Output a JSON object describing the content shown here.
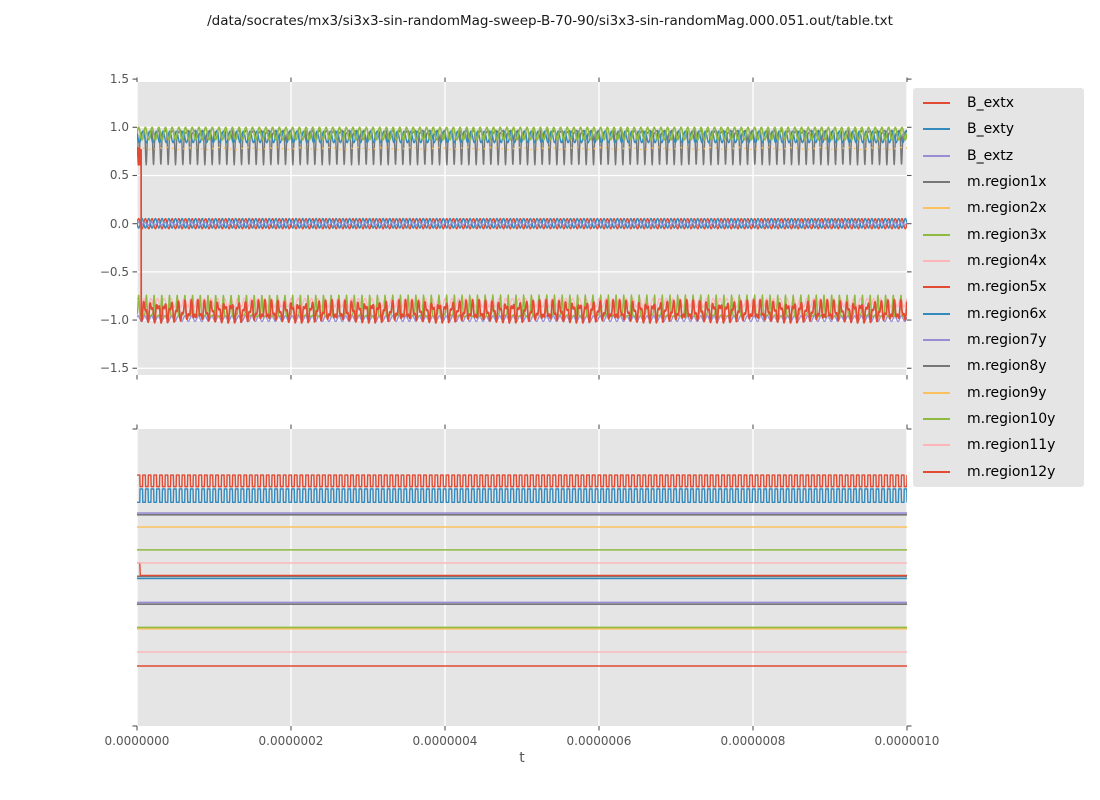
{
  "title": "/data/socrates/mx3/si3x3-sin-randomMag-sweep-B-70-90/si3x3-sin-randomMag.000.051.out/table.txt",
  "colors": {
    "figure_bg": "#ffffff",
    "axes_bg": "#e5e5e5",
    "grid": "#ffffff",
    "tick_mark": "#555555",
    "tick_label": "#555555",
    "title_text": "#1a1a1a",
    "legend_bg": "#e5e5e5",
    "palette_red": "#e24a33",
    "palette_blue": "#348abd",
    "palette_purple": "#988ed5",
    "palette_gray": "#777777",
    "palette_orange": "#fbc15e",
    "palette_green": "#8eba42",
    "palette_pink": "#ffb5b8"
  },
  "legend": {
    "entries": [
      {
        "label": "B_extx",
        "color": "#e24a33"
      },
      {
        "label": "B_exty",
        "color": "#348abd"
      },
      {
        "label": "B_extz",
        "color": "#988ed5"
      },
      {
        "label": "m.region1x",
        "color": "#777777"
      },
      {
        "label": "m.region2x",
        "color": "#fbc15e"
      },
      {
        "label": "m.region3x",
        "color": "#8eba42"
      },
      {
        "label": "m.region4x",
        "color": "#ffb5b8"
      },
      {
        "label": "m.region5x",
        "color": "#e24a33"
      },
      {
        "label": "m.region6x",
        "color": "#348abd"
      },
      {
        "label": "m.region7y",
        "color": "#988ed5"
      },
      {
        "label": "m.region8y",
        "color": "#777777"
      },
      {
        "label": "m.region9y",
        "color": "#fbc15e"
      },
      {
        "label": "m.region10y",
        "color": "#8eba42"
      },
      {
        "label": "m.region11y",
        "color": "#ffb5b8"
      },
      {
        "label": "m.region12y",
        "color": "#e24a33"
      }
    ]
  },
  "chart_data": [
    {
      "type": "line",
      "title": "",
      "xlabel": "",
      "ylabel": "",
      "xlim": [
        0,
        1e-06
      ],
      "ylim": [
        -1.57,
        1.47
      ],
      "xticks": [
        0,
        2e-07,
        4e-07,
        6e-07,
        8e-07,
        1e-06
      ],
      "xtick_labels": [],
      "yticks": [
        1.5,
        1.0,
        0.5,
        0.0,
        -0.5,
        -1.0,
        -1.5
      ],
      "ytick_labels": [
        "1.5",
        "1.0",
        "0.5",
        "0.0",
        "−0.5",
        "−1.0",
        "−1.5"
      ],
      "grid": "white, horizontal and vertical at ticks",
      "legend_position": "outside right",
      "series": [
        {
          "name": "B_extx",
          "color": "#e24a33",
          "wave": "sine",
          "center": 0.0,
          "amp": 0.053,
          "cycles": 115,
          "phase": 0,
          "lw": 1.4
        },
        {
          "name": "B_exty",
          "color": "#348abd",
          "wave": "sine",
          "center": 0.004,
          "amp": 0.05,
          "cycles": 115,
          "phase": 3.14,
          "lw": 1.4
        },
        {
          "name": "B_extz",
          "color": "#988ed5",
          "wave": "sine",
          "center": 0.0,
          "amp": 0.018,
          "cycles": 115,
          "phase": 0.8,
          "lw": 1.3
        },
        {
          "name": "m.region1x",
          "color": "#777777",
          "wave": "spike",
          "base": 0.955,
          "height": -0.345,
          "power": 6,
          "cycles": 105,
          "phase": 0,
          "wobble": 0.015,
          "lw": 1.4
        },
        {
          "name": "m.region2x",
          "color": "#fbc15e",
          "wave": "sine",
          "center": 0.78,
          "amp": 0.012,
          "cycles": 105,
          "phase": 0.9,
          "lw": 1.3,
          "dash": "2 5"
        },
        {
          "name": "m.region6x",
          "color": "#348abd",
          "wave": "sine",
          "center": 0.9,
          "amp": 0.06,
          "cycles": 115,
          "phase": 2.3,
          "lw": 1.4
        },
        {
          "name": "m.region3x",
          "color": "#8eba42",
          "wave": "sine",
          "center": 0.935,
          "amp": 0.065,
          "cycles": 115,
          "phase": 0,
          "lw": 1.6
        },
        {
          "name": "m.region4x",
          "color": "#ffb5b8",
          "wave": "sine",
          "center": -0.82,
          "amp": 0.045,
          "cycles": 115,
          "phase": 1.2,
          "lw": 1.3
        },
        {
          "name": "m.region7y",
          "color": "#988ed5",
          "wave": "sine",
          "center": -0.985,
          "amp": 0.03,
          "cycles": 115,
          "phase": 0.5,
          "lw": 1.3
        },
        {
          "name": "m.region10y",
          "color": "#8eba42",
          "wave": "spike",
          "base": -0.955,
          "height": 0.215,
          "power": 8,
          "cycles": 100,
          "phase": 0.2,
          "wobble": 0.01,
          "lw": 1.4
        },
        {
          "name": "m.region5x",
          "color": "#e24a33",
          "wave": "piecewise",
          "x0": 0.0055,
          "pre": {
            "wave": "sine",
            "center": 0.7,
            "amp": 0.09,
            "cycles": 400,
            "phase": 0
          },
          "post": {
            "wave": "sine2",
            "center": -0.91,
            "amp": 0.075,
            "cycles": 115,
            "phase": 0.9,
            "amp2": 0.045,
            "cycles2": 241,
            "phase2": 1.3
          },
          "lw": 1.7
        }
      ]
    },
    {
      "type": "line",
      "title": "",
      "xlabel": "t",
      "ylabel": "",
      "xlim": [
        0,
        1e-06
      ],
      "ylim": [
        0,
        1
      ],
      "xticks": [
        0,
        2e-07,
        4e-07,
        6e-07,
        8e-07,
        1e-06
      ],
      "xtick_labels": [
        "0.0000000",
        "0.0000002",
        "0.0000004",
        "0.0000006",
        "0.0000008",
        "0.0000010"
      ],
      "yticks": [],
      "ytick_labels": [],
      "note": "no y-axis tick labels shown; y values normalized 0-1 of axes height",
      "series": [
        {
          "id": "gray-flat-under-blue",
          "color": "#777777",
          "wave": "flat",
          "value": 0.504,
          "lw": 1.6
        },
        {
          "id": "blue-flat",
          "color": "#348abd",
          "wave": "flat",
          "value": 0.497,
          "lw": 1.6
        },
        {
          "id": "red-step-down",
          "color": "#e24a33",
          "wave": "step",
          "x0": 0.004,
          "v1": 0.549,
          "v2": 0.507,
          "lw": 1.4
        },
        {
          "id": "gray-flat-under-purple-1",
          "color": "#777777",
          "wave": "flat",
          "value": 0.711,
          "lw": 1.6
        },
        {
          "id": "purple-flat-1",
          "color": "#988ed5",
          "wave": "flat",
          "value": 0.717,
          "lw": 1.6
        },
        {
          "id": "orange-flat-1",
          "color": "#fbc15e",
          "wave": "flat",
          "value": 0.67,
          "lw": 1.4
        },
        {
          "id": "green-flat-1",
          "color": "#8eba42",
          "wave": "flat",
          "value": 0.593,
          "lw": 1.4
        },
        {
          "id": "pink-flat-1",
          "color": "#ffb5b8",
          "wave": "flat",
          "value": 0.549,
          "lw": 1.4
        },
        {
          "id": "gray-flat-under-purple-2",
          "color": "#777777",
          "wave": "flat",
          "value": 0.41,
          "lw": 1.6
        },
        {
          "id": "purple-flat-2",
          "color": "#988ed5",
          "wave": "flat",
          "value": 0.416,
          "lw": 1.6
        },
        {
          "id": "orange-flat-under-green",
          "color": "#fbc15e",
          "wave": "flat",
          "value": 0.327,
          "lw": 1.4
        },
        {
          "id": "green-flat-2",
          "color": "#8eba42",
          "wave": "flat",
          "value": 0.332,
          "lw": 1.6
        },
        {
          "id": "pink-flat-2",
          "color": "#ffb5b8",
          "wave": "flat",
          "value": 0.249,
          "lw": 1.4
        },
        {
          "id": "red-flat",
          "color": "#e24a33",
          "wave": "flat",
          "value": 0.202,
          "lw": 1.4
        },
        {
          "id": "red-square-wave",
          "color": "#e24a33",
          "wave": "square",
          "high": 0.845,
          "low": 0.806,
          "cycles": 137,
          "duty": 0.5,
          "phase": 0,
          "lw": 1.4
        },
        {
          "id": "blue-square-wave",
          "color": "#348abd",
          "wave": "square",
          "high": 0.798,
          "low": 0.753,
          "cycles": 137,
          "duty": 0.5,
          "phase": 0.5,
          "lw": 1.4
        }
      ]
    }
  ]
}
